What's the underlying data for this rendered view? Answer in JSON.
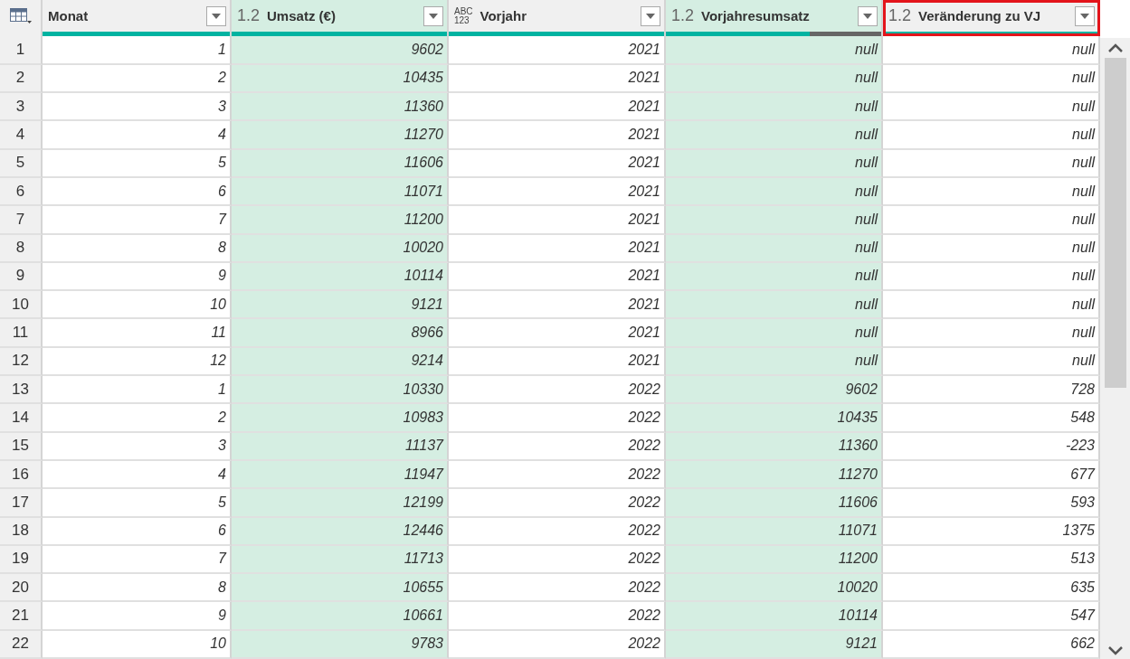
{
  "columns": [
    {
      "name": "Monat",
      "selected": false,
      "highlighted": false,
      "level": 1
    },
    {
      "name": "Umsatz (€)",
      "type_label": [
        "1.2"
      ],
      "selected": true,
      "highlighted": false,
      "level": 1
    },
    {
      "name": "Vorjahr",
      "type_label": [
        "ABC",
        "123"
      ],
      "selected": false,
      "highlighted": false,
      "level": 1
    },
    {
      "name": "Vorjahresumsatz",
      "type_label": [
        "1.2"
      ],
      "selected": true,
      "highlighted": false,
      "level": 0.67
    },
    {
      "name": "Veränderung zu VJ",
      "type_label": [
        "1.2"
      ],
      "selected": false,
      "highlighted": true,
      "level": 1
    }
  ],
  "rows": [
    {
      "index": "1",
      "cells": [
        "1",
        "9602",
        "2021",
        "null",
        "null"
      ]
    },
    {
      "index": "2",
      "cells": [
        "2",
        "10435",
        "2021",
        "null",
        "null"
      ]
    },
    {
      "index": "3",
      "cells": [
        "3",
        "11360",
        "2021",
        "null",
        "null"
      ]
    },
    {
      "index": "4",
      "cells": [
        "4",
        "11270",
        "2021",
        "null",
        "null"
      ]
    },
    {
      "index": "5",
      "cells": [
        "5",
        "11606",
        "2021",
        "null",
        "null"
      ]
    },
    {
      "index": "6",
      "cells": [
        "6",
        "11071",
        "2021",
        "null",
        "null"
      ]
    },
    {
      "index": "7",
      "cells": [
        "7",
        "11200",
        "2021",
        "null",
        "null"
      ]
    },
    {
      "index": "8",
      "cells": [
        "8",
        "10020",
        "2021",
        "null",
        "null"
      ]
    },
    {
      "index": "9",
      "cells": [
        "9",
        "10114",
        "2021",
        "null",
        "null"
      ]
    },
    {
      "index": "10",
      "cells": [
        "10",
        "9121",
        "2021",
        "null",
        "null"
      ]
    },
    {
      "index": "11",
      "cells": [
        "11",
        "8966",
        "2021",
        "null",
        "null"
      ]
    },
    {
      "index": "12",
      "cells": [
        "12",
        "9214",
        "2021",
        "null",
        "null"
      ]
    },
    {
      "index": "13",
      "cells": [
        "1",
        "10330",
        "2022",
        "9602",
        "728"
      ]
    },
    {
      "index": "14",
      "cells": [
        "2",
        "10983",
        "2022",
        "10435",
        "548"
      ]
    },
    {
      "index": "15",
      "cells": [
        "3",
        "11137",
        "2022",
        "11360",
        "-223"
      ]
    },
    {
      "index": "16",
      "cells": [
        "4",
        "11947",
        "2022",
        "11270",
        "677"
      ]
    },
    {
      "index": "17",
      "cells": [
        "5",
        "12199",
        "2022",
        "11606",
        "593"
      ]
    },
    {
      "index": "18",
      "cells": [
        "6",
        "12446",
        "2022",
        "11071",
        "1375"
      ]
    },
    {
      "index": "19",
      "cells": [
        "7",
        "11713",
        "2022",
        "11200",
        "513"
      ]
    },
    {
      "index": "20",
      "cells": [
        "8",
        "10655",
        "2022",
        "10020",
        "635"
      ]
    },
    {
      "index": "21",
      "cells": [
        "9",
        "10661",
        "2022",
        "10114",
        "547"
      ]
    },
    {
      "index": "22",
      "cells": [
        "10",
        "9783",
        "2022",
        "9121",
        "662"
      ]
    }
  ]
}
